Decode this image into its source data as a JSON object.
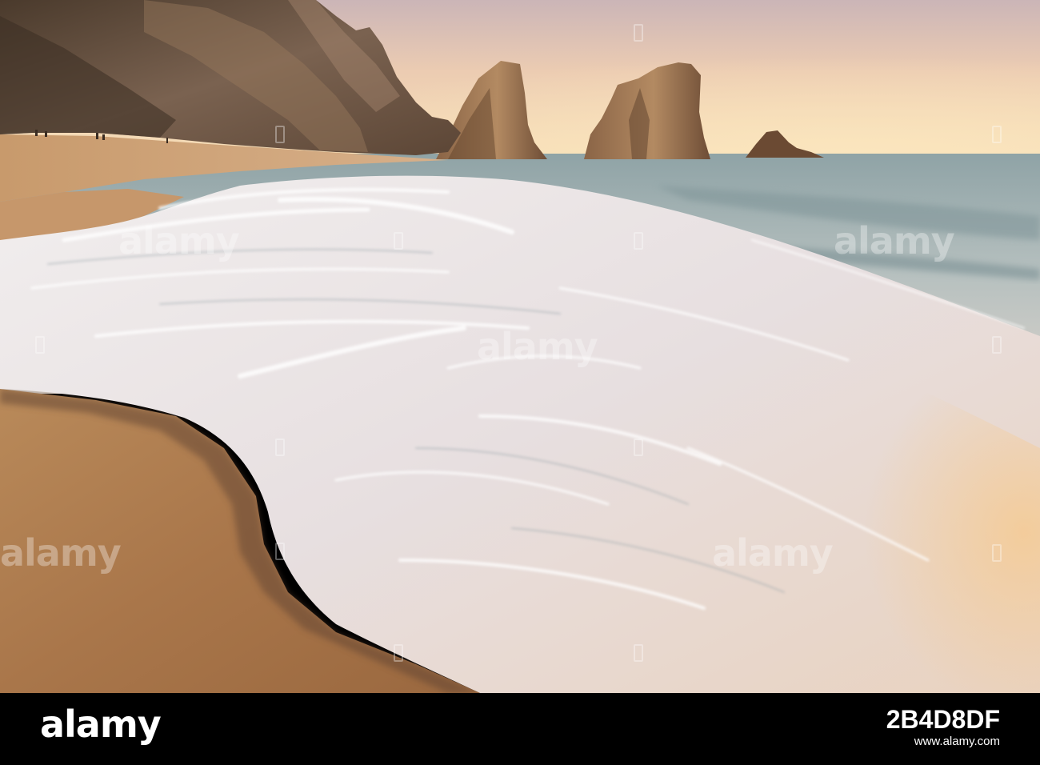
{
  "watermark": {
    "text": "alamy"
  },
  "footer": {
    "logo": "alamy",
    "image_id": "2B4D8DF",
    "url": "www.alamy.com"
  },
  "colors": {
    "background": "#000000",
    "footer_text": "#ffffff"
  }
}
